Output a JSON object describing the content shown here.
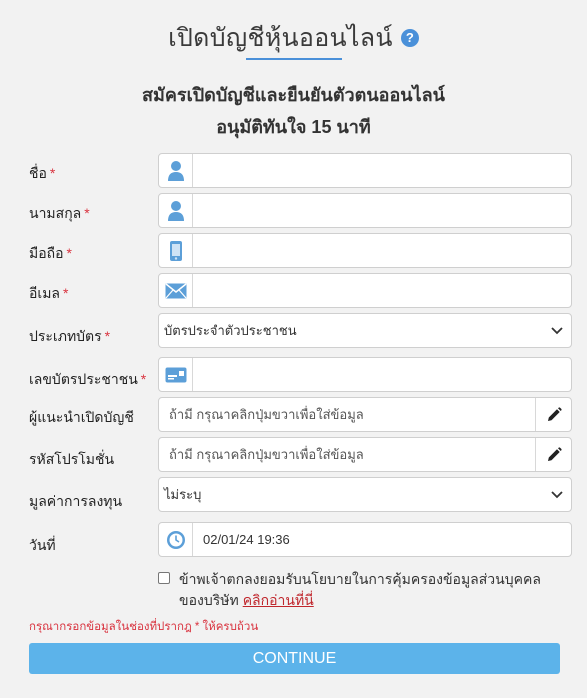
{
  "header": {
    "title": "เปิดบัญชีหุ้นออนไลน์",
    "help_icon": "?",
    "subtitle": "สมัครเปิดบัญชีและยืนยันตัวตนออนไลน์",
    "subtitle2": "อนุมัติทันใจ 15 นาที"
  },
  "form": {
    "required_mark": "*",
    "first_name": {
      "label": "ชื่อ",
      "value": "",
      "icon": "user-icon"
    },
    "last_name": {
      "label": "นามสกุล",
      "value": "",
      "icon": "user-icon"
    },
    "mobile": {
      "label": "มือถือ",
      "value": "",
      "icon": "mobile-phone-icon"
    },
    "email": {
      "label": "อีเมล",
      "value": "",
      "icon": "envelope-icon"
    },
    "card_type": {
      "label": "ประเภทบัตร",
      "selected": "บัตรประจำตัวประชาชน"
    },
    "card_number": {
      "label": "เลขบัตรประชาชน",
      "value": "",
      "icon": "id-card-icon"
    },
    "referrer": {
      "label": "ผู้แนะนำเปิดบัญชี",
      "placeholder": "ถ้ามี กรุณาคลิกปุ่มขวาเพื่อใส่ข้อมูล",
      "icon": "pencil-icon"
    },
    "promo": {
      "label": "รหัสโปรโมชั่น",
      "placeholder": "ถ้ามี กรุณาคลิกปุ่มขวาเพื่อใส่ข้อมูล",
      "icon": "pencil-icon"
    },
    "investment": {
      "label": "มูลค่าการลงทุน",
      "selected": "ไม่ระบุ"
    },
    "date": {
      "label": "วันที่",
      "value": "02/01/24 19:36",
      "icon": "clock-icon"
    }
  },
  "consent": {
    "text": "ข้าพเจ้าตกลงยอมรับนโยบายในการคุ้มครองข้อมูลส่วนบุคคลของบริษัท",
    "link": "คลิกอ่านที่นี่",
    "checked": false
  },
  "warning": "กรุณากรอกข้อมูลในช่องที่ปรากฎ * ให้ครบถ้วน",
  "continue_label": "CONTINUE",
  "colors": {
    "accent": "#4a90d9",
    "button": "#5cb3ea",
    "required": "#d9333f",
    "link": "#c0272d"
  }
}
